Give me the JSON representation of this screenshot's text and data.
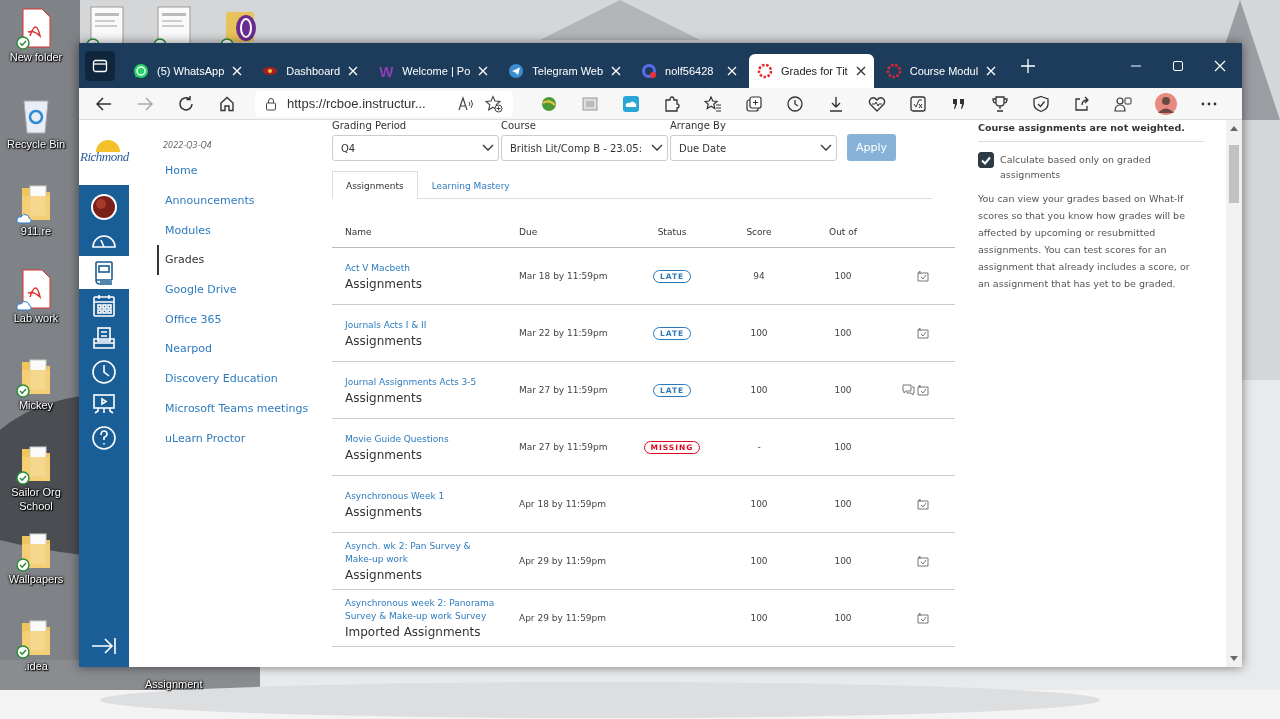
{
  "desktop": {
    "top_icons": [
      {
        "kind": "document",
        "synced": true
      },
      {
        "kind": "document",
        "synced": true
      },
      {
        "kind": "app",
        "synced": true
      }
    ],
    "icons": [
      {
        "label": "New folder",
        "kind": "pdf",
        "synced": true,
        "cloud": false
      },
      {
        "label": "Recycle Bin",
        "kind": "bin",
        "synced": false,
        "cloud": false
      },
      {
        "label": "911.re",
        "kind": "folder",
        "synced": false,
        "cloud": true
      },
      {
        "label": "Lab work",
        "kind": "pdf",
        "synced": false,
        "cloud": true
      },
      {
        "label": "Mickey",
        "kind": "folder",
        "synced": true,
        "cloud": false
      },
      {
        "label": "Sailor Org School",
        "kind": "folder",
        "synced": true,
        "cloud": false
      },
      {
        "label": "Wallpapers",
        "kind": "folder",
        "synced": true,
        "cloud": false
      },
      {
        "label": ".idea",
        "kind": "folder",
        "synced": true,
        "cloud": false
      }
    ],
    "stray_labels": [
      "Assignment"
    ]
  },
  "browser": {
    "tabs": [
      {
        "label": "(5) WhatsApp",
        "kind": "whatsapp",
        "selected": false
      },
      {
        "label": "Dashboard",
        "kind": "dashboard",
        "selected": false
      },
      {
        "label": "Welcome | Po",
        "kind": "letter",
        "favicon_text": "W",
        "selected": false
      },
      {
        "label": "Telegram Web",
        "kind": "telegram",
        "selected": false
      },
      {
        "label": "nolf56428",
        "kind": "ring",
        "selected": false
      },
      {
        "label": "Grades for Tit",
        "kind": "canvas",
        "selected": true
      },
      {
        "label": "Course Modul",
        "kind": "canvas",
        "selected": false
      }
    ],
    "url": "https://rcboe.instructur...",
    "forward_enabled": false
  },
  "canvas": {
    "logo": {
      "name": "Richmond"
    },
    "global_nav": [
      {
        "kind": "account",
        "selected": false
      },
      {
        "kind": "dashboard",
        "selected": false
      },
      {
        "kind": "courses",
        "selected": true
      },
      {
        "kind": "calendar",
        "selected": false
      },
      {
        "kind": "inbox",
        "selected": false
      },
      {
        "kind": "history",
        "selected": false
      },
      {
        "kind": "studio",
        "selected": false
      },
      {
        "kind": "help",
        "selected": false
      }
    ],
    "term": "2022-Q3-Q4",
    "course_nav": [
      {
        "label": "Home",
        "selected": false
      },
      {
        "label": "Announcements",
        "selected": false
      },
      {
        "label": "Modules",
        "selected": false
      },
      {
        "label": "Grades",
        "selected": true
      },
      {
        "label": "Google Drive",
        "selected": false
      },
      {
        "label": "Office 365",
        "selected": false
      },
      {
        "label": "Nearpod",
        "selected": false
      },
      {
        "label": "Discovery Education",
        "selected": false
      },
      {
        "label": "Microsoft Teams meetings",
        "selected": false
      },
      {
        "label": "uLearn Proctor",
        "selected": false
      }
    ],
    "filters": [
      {
        "label": "Grading Period",
        "value": "Q4"
      },
      {
        "label": "Course",
        "value": "British Lit/Comp B - 23.05:"
      },
      {
        "label": "Arrange By",
        "value": "Due Date"
      }
    ],
    "apply": "Apply",
    "view_tabs": [
      {
        "label": "Assignments",
        "selected": true
      },
      {
        "label": "Learning Mastery",
        "selected": false
      }
    ],
    "table": {
      "columns": [
        "Name",
        "Due",
        "Status",
        "Score",
        "Out of"
      ],
      "rows": [
        {
          "name": "Act V Macbeth",
          "group": "Assignments",
          "due": "Mar 18 by 11:59pm",
          "status": {
            "kind": "late",
            "label": "LATE"
          },
          "score": "94",
          "out_of": "100",
          "comment": false,
          "what_if": true
        },
        {
          "name": "Journals Acts I & II",
          "group": "Assignments",
          "due": "Mar 22 by 11:59pm",
          "status": {
            "kind": "late",
            "label": "LATE"
          },
          "score": "100",
          "out_of": "100",
          "comment": false,
          "what_if": true
        },
        {
          "name": "Journal Assignments Acts 3-5",
          "group": "Assignments",
          "due": "Mar 27 by 11:59pm",
          "status": {
            "kind": "late",
            "label": "LATE"
          },
          "score": "100",
          "out_of": "100",
          "comment": true,
          "what_if": true
        },
        {
          "name": "Movie Guide Questions",
          "group": "Assignments",
          "due": "Mar 27 by 11:59pm",
          "status": {
            "kind": "missing",
            "label": "MISSING"
          },
          "score": "-",
          "out_of": "100",
          "comment": false,
          "what_if": false
        },
        {
          "name": "Asynchronous Week 1",
          "group": "Assignments",
          "due": "Apr 18 by 11:59pm",
          "score": "100",
          "out_of": "100",
          "comment": false,
          "what_if": true
        },
        {
          "name": "Asynch. wk 2: Pan Survey & Make-up work",
          "group": "Assignments",
          "due": "Apr 29 by 11:59pm",
          "score": "100",
          "out_of": "100",
          "comment": false,
          "what_if": true
        },
        {
          "name": "Asynchronous week 2: Panorama Survey & Make-up work Survey",
          "group": "Imported Assignments",
          "due": "Apr 29 by 11:59pm",
          "score": "100",
          "out_of": "100",
          "comment": false,
          "what_if": true
        }
      ]
    },
    "side": {
      "note": "Course assignments are not weighted.",
      "checkbox": {
        "label": "Calculate based only on graded assignments",
        "checked": true
      },
      "paragraph": "You can view your grades based on What-If scores so that you know how grades will be affected by upcoming or resubmitted assignments. You can test scores for an assignment that already includes a score, or an assignment that has yet to be graded."
    }
  }
}
